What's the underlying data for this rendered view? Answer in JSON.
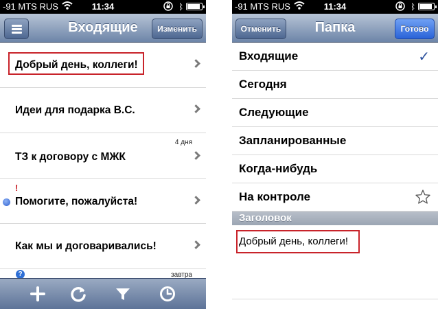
{
  "left": {
    "status": {
      "carrier": "-91 MTS RUS",
      "time": "11:34"
    },
    "nav": {
      "title": "Входящие",
      "edit_label": "Изменить"
    },
    "rows": [
      {
        "subject": "Добрый день, коллеги!",
        "date": ""
      },
      {
        "subject": "Идеи для подарка В.С.",
        "date": ""
      },
      {
        "subject": "ТЗ к договору с МЖК",
        "date": "4 дня"
      },
      {
        "subject": "Помогите, пожалуйста!",
        "date": ""
      },
      {
        "subject": "Как мы и договаривались!",
        "date": ""
      }
    ],
    "priority_flag": "!",
    "partial_row": {
      "help_icon": "?",
      "date": "завтра"
    },
    "toolbar": [
      "plus-icon",
      "refresh-icon",
      "filter-icon",
      "clock-icon"
    ]
  },
  "right": {
    "status": {
      "carrier": "-91 MTS RUS",
      "time": "11:34"
    },
    "nav": {
      "title": "Папка",
      "cancel_label": "Отменить",
      "done_label": "Готово"
    },
    "folders": [
      "Входящие",
      "Сегодня",
      "Следующие",
      "Запланированные",
      "Когда-нибудь",
      "На контроле"
    ],
    "selected_mark": "✓",
    "section_label": "Заголовок",
    "heading_value": "Добрый день, коллеги!"
  },
  "colors": {
    "highlight": "#c8232a",
    "nav": "#6d85a8",
    "done_button": "#2a63d8"
  }
}
